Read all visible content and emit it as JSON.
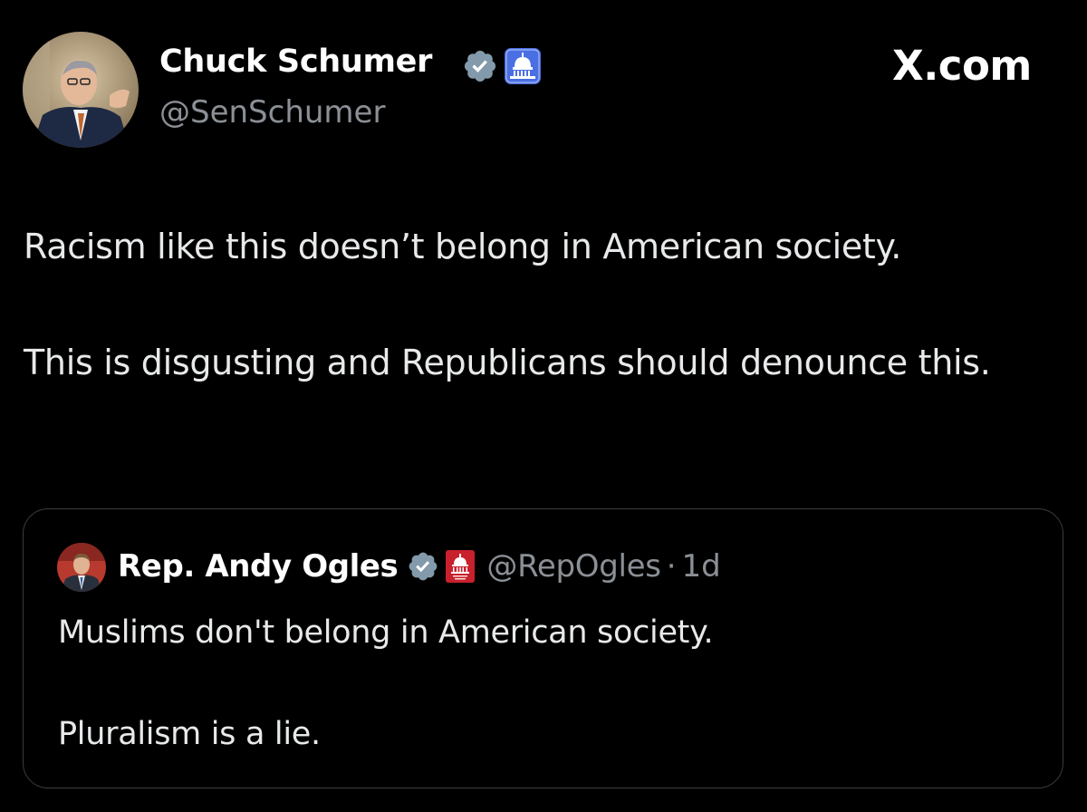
{
  "post": {
    "author": {
      "name": "Chuck Schumer",
      "handle": "@SenSchumer",
      "avatar_icon": "person-photo-avatar",
      "verified_icon": "verified-badge-icon",
      "affiliation_icon": "capitol-dome-icon"
    },
    "site": "X.com",
    "text": [
      "Racism like this doesn’t belong in American society.",
      "This is disgusting and Republicans should denounce this."
    ]
  },
  "quoted_post": {
    "author": {
      "name": "Rep. Andy Ogles",
      "handle": "@RepOgles",
      "separator": "·",
      "timestamp": "1d",
      "avatar_icon": "person-photo-avatar",
      "verified_icon": "verified-badge-icon",
      "affiliation_icon": "house-gop-icon"
    },
    "text": [
      "Muslims don't belong in American society.",
      "Pluralism is a lie."
    ]
  },
  "colors": {
    "background": "#000000",
    "text_primary": "#e7e9ea",
    "text_secondary": "#8b9096",
    "border": "#3a3d40",
    "verified_badge": "#829aab",
    "affiliation_blue": "#4a6fe3",
    "affiliation_red": "#c8202c"
  }
}
